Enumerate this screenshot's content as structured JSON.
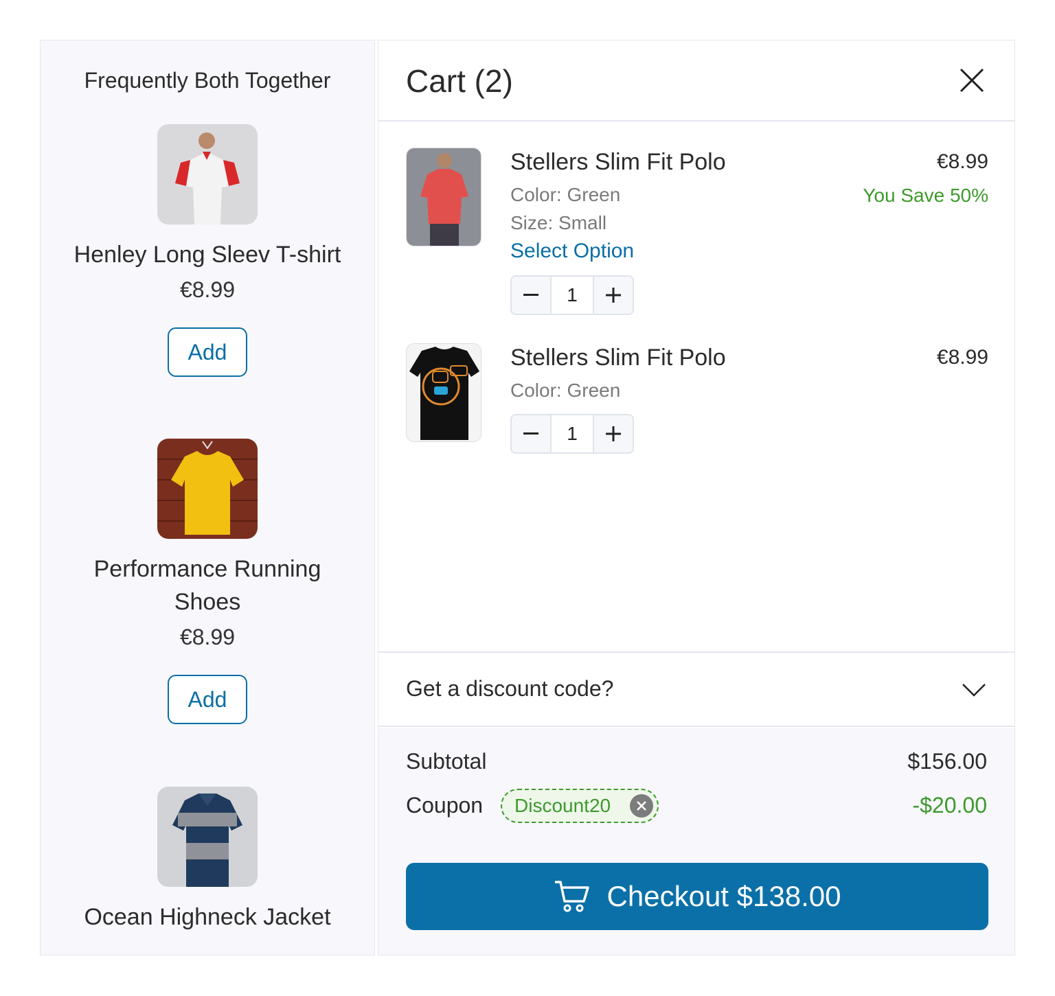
{
  "fbt": {
    "title": "Frequently Both Together",
    "products": [
      {
        "name": "Henley Long Sleev T-shirt",
        "price": "€8.99",
        "add_label": "Add",
        "image": "white-red-polo-photo"
      },
      {
        "name": "Performance Running Shoes",
        "price": "€8.99",
        "add_label": "Add",
        "image": "yellow-tshirt-photo"
      },
      {
        "name": "Ocean Highneck Jacket",
        "image": "navy-striped-polo-photo"
      }
    ]
  },
  "cart": {
    "title": "Cart (2)",
    "close_icon": "close-icon",
    "items": [
      {
        "name": "Stellers Slim Fit Polo",
        "color": "Color: Green",
        "size": "Size: Small",
        "option_label": "Select Option",
        "price": "€8.99",
        "save": "You Save 50%",
        "qty": "1",
        "image": "red-polo-photo"
      },
      {
        "name": "Stellers Slim Fit Polo",
        "color": "Color: Green",
        "price": "€8.99",
        "qty": "1",
        "image": "black-ai-tshirt-photo"
      }
    ],
    "discount_label": "Get a discount code?",
    "subtotal_label": "Subtotal",
    "subtotal_value": "$156.00",
    "coupon_label": "Coupon",
    "coupon_code": "Discount20",
    "coupon_value": "-$20.00",
    "checkout_label": "Checkout $138.00"
  },
  "colors": {
    "accent": "#0b70a8",
    "success": "#3d9a2c",
    "panel_bg": "#f7f7fc"
  }
}
